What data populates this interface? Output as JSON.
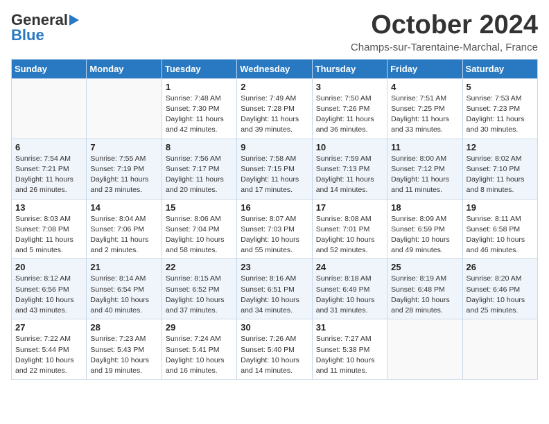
{
  "header": {
    "logo_general": "General",
    "logo_blue": "Blue",
    "month_title": "October 2024",
    "subtitle": "Champs-sur-Tarentaine-Marchal, France"
  },
  "days_of_week": [
    "Sunday",
    "Monday",
    "Tuesday",
    "Wednesday",
    "Thursday",
    "Friday",
    "Saturday"
  ],
  "weeks": [
    [
      {
        "day": "",
        "info": ""
      },
      {
        "day": "",
        "info": ""
      },
      {
        "day": "1",
        "info": "Sunrise: 7:48 AM\nSunset: 7:30 PM\nDaylight: 11 hours and 42 minutes."
      },
      {
        "day": "2",
        "info": "Sunrise: 7:49 AM\nSunset: 7:28 PM\nDaylight: 11 hours and 39 minutes."
      },
      {
        "day": "3",
        "info": "Sunrise: 7:50 AM\nSunset: 7:26 PM\nDaylight: 11 hours and 36 minutes."
      },
      {
        "day": "4",
        "info": "Sunrise: 7:51 AM\nSunset: 7:25 PM\nDaylight: 11 hours and 33 minutes."
      },
      {
        "day": "5",
        "info": "Sunrise: 7:53 AM\nSunset: 7:23 PM\nDaylight: 11 hours and 30 minutes."
      }
    ],
    [
      {
        "day": "6",
        "info": "Sunrise: 7:54 AM\nSunset: 7:21 PM\nDaylight: 11 hours and 26 minutes."
      },
      {
        "day": "7",
        "info": "Sunrise: 7:55 AM\nSunset: 7:19 PM\nDaylight: 11 hours and 23 minutes."
      },
      {
        "day": "8",
        "info": "Sunrise: 7:56 AM\nSunset: 7:17 PM\nDaylight: 11 hours and 20 minutes."
      },
      {
        "day": "9",
        "info": "Sunrise: 7:58 AM\nSunset: 7:15 PM\nDaylight: 11 hours and 17 minutes."
      },
      {
        "day": "10",
        "info": "Sunrise: 7:59 AM\nSunset: 7:13 PM\nDaylight: 11 hours and 14 minutes."
      },
      {
        "day": "11",
        "info": "Sunrise: 8:00 AM\nSunset: 7:12 PM\nDaylight: 11 hours and 11 minutes."
      },
      {
        "day": "12",
        "info": "Sunrise: 8:02 AM\nSunset: 7:10 PM\nDaylight: 11 hours and 8 minutes."
      }
    ],
    [
      {
        "day": "13",
        "info": "Sunrise: 8:03 AM\nSunset: 7:08 PM\nDaylight: 11 hours and 5 minutes."
      },
      {
        "day": "14",
        "info": "Sunrise: 8:04 AM\nSunset: 7:06 PM\nDaylight: 11 hours and 2 minutes."
      },
      {
        "day": "15",
        "info": "Sunrise: 8:06 AM\nSunset: 7:04 PM\nDaylight: 10 hours and 58 minutes."
      },
      {
        "day": "16",
        "info": "Sunrise: 8:07 AM\nSunset: 7:03 PM\nDaylight: 10 hours and 55 minutes."
      },
      {
        "day": "17",
        "info": "Sunrise: 8:08 AM\nSunset: 7:01 PM\nDaylight: 10 hours and 52 minutes."
      },
      {
        "day": "18",
        "info": "Sunrise: 8:09 AM\nSunset: 6:59 PM\nDaylight: 10 hours and 49 minutes."
      },
      {
        "day": "19",
        "info": "Sunrise: 8:11 AM\nSunset: 6:58 PM\nDaylight: 10 hours and 46 minutes."
      }
    ],
    [
      {
        "day": "20",
        "info": "Sunrise: 8:12 AM\nSunset: 6:56 PM\nDaylight: 10 hours and 43 minutes."
      },
      {
        "day": "21",
        "info": "Sunrise: 8:14 AM\nSunset: 6:54 PM\nDaylight: 10 hours and 40 minutes."
      },
      {
        "day": "22",
        "info": "Sunrise: 8:15 AM\nSunset: 6:52 PM\nDaylight: 10 hours and 37 minutes."
      },
      {
        "day": "23",
        "info": "Sunrise: 8:16 AM\nSunset: 6:51 PM\nDaylight: 10 hours and 34 minutes."
      },
      {
        "day": "24",
        "info": "Sunrise: 8:18 AM\nSunset: 6:49 PM\nDaylight: 10 hours and 31 minutes."
      },
      {
        "day": "25",
        "info": "Sunrise: 8:19 AM\nSunset: 6:48 PM\nDaylight: 10 hours and 28 minutes."
      },
      {
        "day": "26",
        "info": "Sunrise: 8:20 AM\nSunset: 6:46 PM\nDaylight: 10 hours and 25 minutes."
      }
    ],
    [
      {
        "day": "27",
        "info": "Sunrise: 7:22 AM\nSunset: 5:44 PM\nDaylight: 10 hours and 22 minutes."
      },
      {
        "day": "28",
        "info": "Sunrise: 7:23 AM\nSunset: 5:43 PM\nDaylight: 10 hours and 19 minutes."
      },
      {
        "day": "29",
        "info": "Sunrise: 7:24 AM\nSunset: 5:41 PM\nDaylight: 10 hours and 16 minutes."
      },
      {
        "day": "30",
        "info": "Sunrise: 7:26 AM\nSunset: 5:40 PM\nDaylight: 10 hours and 14 minutes."
      },
      {
        "day": "31",
        "info": "Sunrise: 7:27 AM\nSunset: 5:38 PM\nDaylight: 10 hours and 11 minutes."
      },
      {
        "day": "",
        "info": ""
      },
      {
        "day": "",
        "info": ""
      }
    ]
  ]
}
